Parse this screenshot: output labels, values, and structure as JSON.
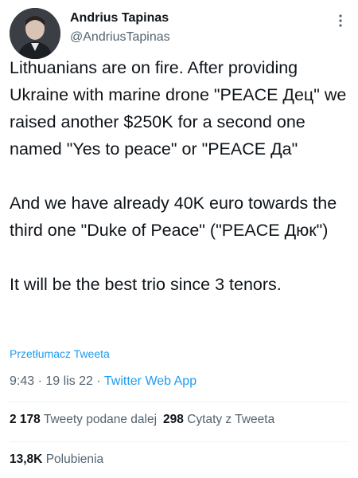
{
  "author": {
    "name": "Andrius Tapinas",
    "handle": "@AndriusTapinas"
  },
  "tweet": {
    "paragraphs": [
      "Lithuanians are on fire. After providing Ukraine with marine drone \"PEACE Дец\" we raised another $250K for a second one named \"Yes to peace\" or \"PEACE Да\"",
      "And we have already 40K euro towards the third one \"Duke of Peace\" (\"PEACE Дюк\")",
      "It will be the best trio since 3 tenors."
    ],
    "translate_link": "Przetłumacz Tweeta",
    "time": "9:43",
    "date": "19 lis 22",
    "source_app": "Twitter Web App",
    "separator": " · "
  },
  "stats": {
    "retweets_count": "2 178",
    "retweets_label": "Tweety podane dalej",
    "quotes_count": "298",
    "quotes_label": "Cytaty z Tweeta",
    "likes_count": "13,8K",
    "likes_label": "Polubienia"
  },
  "colors": {
    "text": "#0f1419",
    "secondary": "#536471",
    "link": "#1d9bf0",
    "divider": "#eff3f4"
  },
  "icons": {
    "more": "more-options-icon"
  }
}
